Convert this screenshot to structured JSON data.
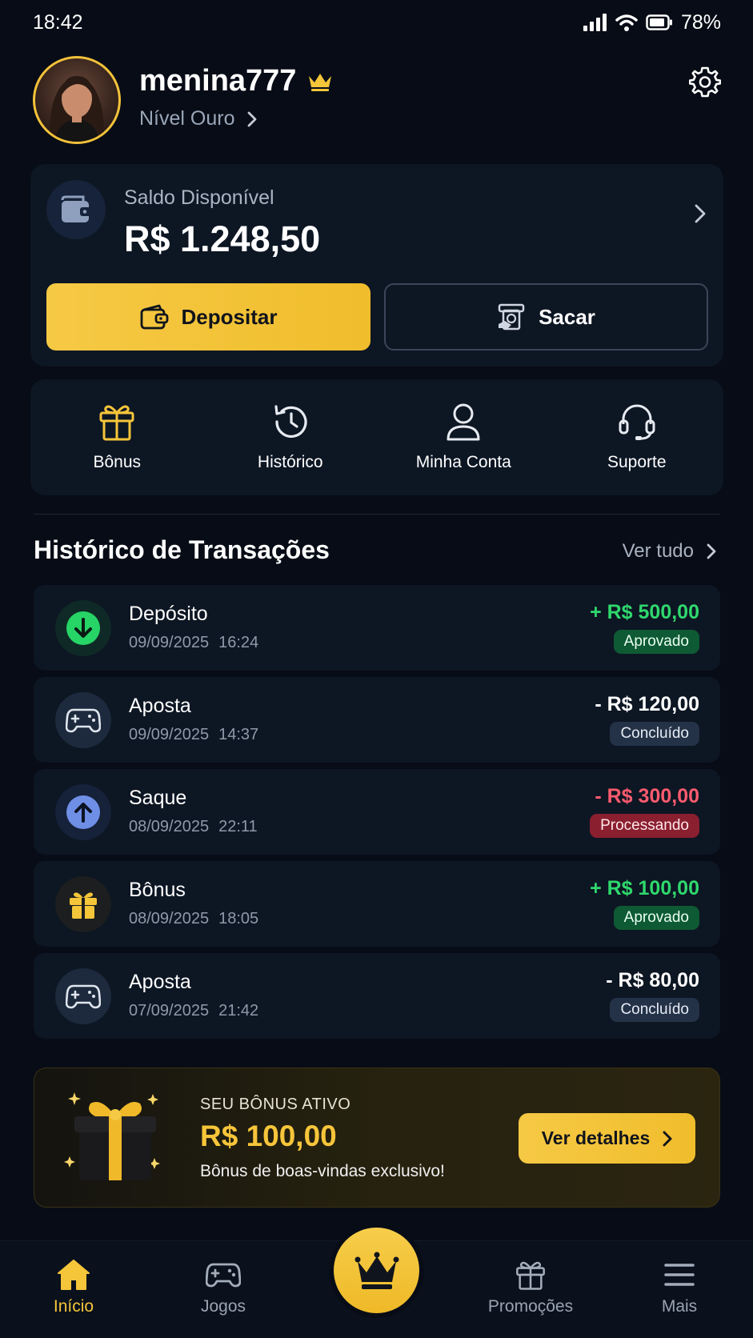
{
  "status_bar": {
    "time": "18:42",
    "battery": "78%"
  },
  "profile": {
    "username": "menina777",
    "level": "Nível Ouro"
  },
  "balance": {
    "label": "Saldo Disponível",
    "value": "R$ 1.248,50",
    "deposit_label": "Depositar",
    "withdraw_label": "Sacar"
  },
  "quick_actions": [
    {
      "label": "Bônus",
      "icon": "gift-icon"
    },
    {
      "label": "Histórico",
      "icon": "history-icon"
    },
    {
      "label": "Minha Conta",
      "icon": "user-icon"
    },
    {
      "label": "Suporte",
      "icon": "headset-icon"
    }
  ],
  "transactions": {
    "title": "Histórico de Transações",
    "see_all": "Ver tudo",
    "items": [
      {
        "title": "Depósito",
        "date": "09/09/2025",
        "time": "16:24",
        "amount": "+ R$ 500,00",
        "status": "Aprovado",
        "icon": "arrow-down-icon"
      },
      {
        "title": "Aposta",
        "date": "09/09/2025",
        "time": "14:37",
        "amount": "- R$ 120,00",
        "status": "Concluído",
        "icon": "gamepad-icon"
      },
      {
        "title": "Saque",
        "date": "08/09/2025",
        "time": "22:11",
        "amount": "- R$ 300,00",
        "status": "Processando",
        "icon": "arrow-up-icon"
      },
      {
        "title": "Bônus",
        "date": "08/09/2025",
        "time": "18:05",
        "amount": "+ R$ 100,00",
        "status": "Aprovado",
        "icon": "gift-icon"
      },
      {
        "title": "Aposta",
        "date": "07/09/2025",
        "time": "21:42",
        "amount": "- R$ 80,00",
        "status": "Concluído",
        "icon": "gamepad-icon"
      }
    ]
  },
  "bonus_banner": {
    "label": "SEU BÔNUS ATIVO",
    "amount": "R$ 100,00",
    "description": "Bônus de boas-vindas exclusivo!",
    "button": "Ver detalhes"
  },
  "bottom_nav": {
    "items": [
      {
        "label": "Início",
        "icon": "home-icon",
        "active": true
      },
      {
        "label": "Jogos",
        "icon": "gamepad-icon",
        "active": false
      },
      {
        "label": "",
        "icon": "crown-icon",
        "active": false
      },
      {
        "label": "Promoções",
        "icon": "gift-icon",
        "active": false
      },
      {
        "label": "Mais",
        "icon": "menu-icon",
        "active": false
      }
    ]
  },
  "colors": {
    "background": "#070c16",
    "card": "#0d1623",
    "accent_gold": "#f5c53a",
    "positive": "#2fd86d",
    "negative": "#ff5b6e",
    "badge_approved": "#0e5a34",
    "badge_done": "#243248",
    "badge_processing": "#8a1f2f"
  }
}
